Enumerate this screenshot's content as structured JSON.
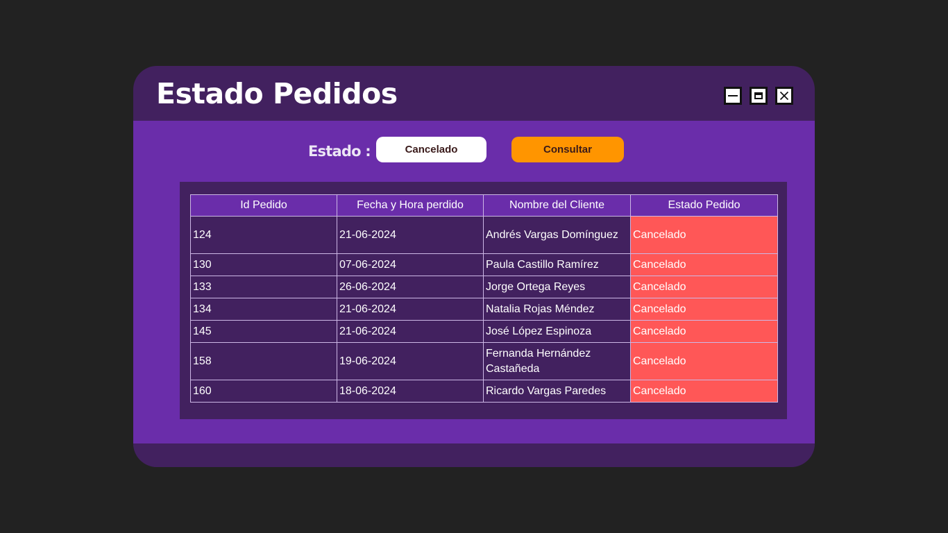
{
  "window": {
    "title": "Estado Pedidos",
    "controls": [
      "minimize-icon",
      "maximize-icon",
      "close-icon"
    ]
  },
  "filter": {
    "label": "Estado :",
    "value": "Cancelado",
    "button_label": "Consultar"
  },
  "table": {
    "headers": [
      "Id Pedido",
      "Fecha y Hora perdido",
      "Nombre del Cliente",
      "Estado Pedido"
    ],
    "rows": [
      {
        "id": "124",
        "fecha": "21-06-2024",
        "cliente": "Andrés Vargas Domínguez",
        "estado": "Cancelado"
      },
      {
        "id": "130",
        "fecha": "07-06-2024",
        "cliente": "Paula Castillo Ramírez",
        "estado": "Cancelado"
      },
      {
        "id": "133",
        "fecha": "26-06-2024",
        "cliente": "Jorge Ortega Reyes",
        "estado": "Cancelado"
      },
      {
        "id": "134",
        "fecha": "21-06-2024",
        "cliente": "Natalia Rojas Méndez",
        "estado": "Cancelado"
      },
      {
        "id": "145",
        "fecha": "21-06-2024",
        "cliente": "José López Espinoza",
        "estado": "Cancelado"
      },
      {
        "id": "158",
        "fecha": "19-06-2024",
        "cliente": "Fernanda Hernández Castañeda",
        "estado": "Cancelado"
      },
      {
        "id": "160",
        "fecha": "18-06-2024",
        "cliente": "Ricardo Vargas Paredes",
        "estado": "Cancelado"
      }
    ]
  },
  "colors": {
    "background": "#222222",
    "window": "#42215f",
    "panel": "#6a2daa",
    "accent": "#ff9500",
    "status_cancelled": "#ff5757"
  }
}
